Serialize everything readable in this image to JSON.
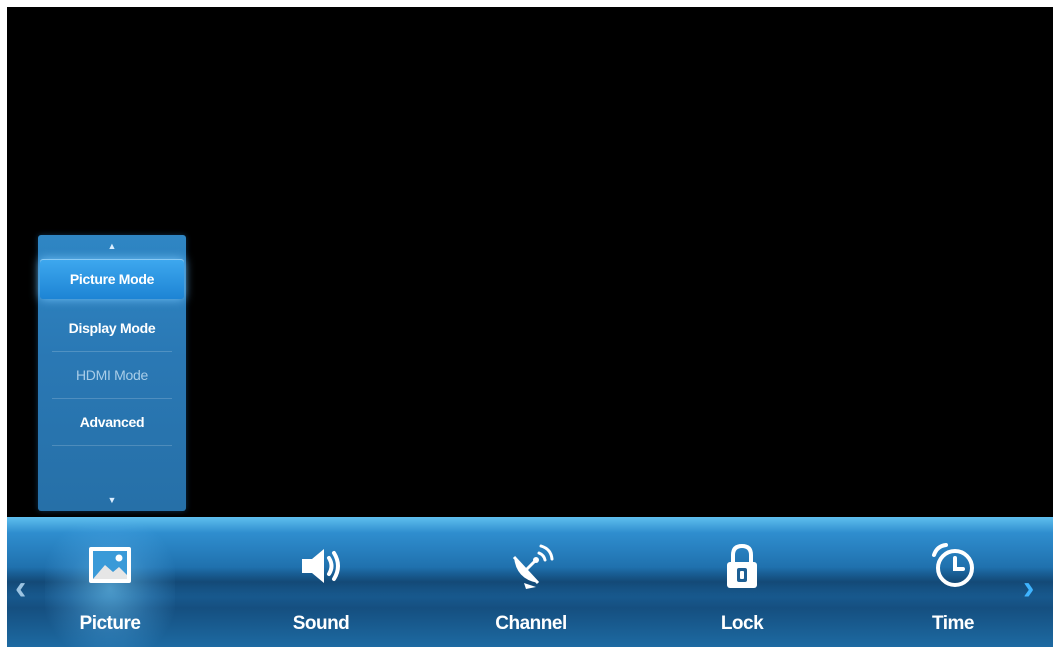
{
  "submenu": {
    "items": [
      {
        "label": "Picture Mode",
        "state": "selected"
      },
      {
        "label": "Display Mode",
        "state": "normal"
      },
      {
        "label": "HDMI Mode",
        "state": "disabled"
      },
      {
        "label": "Advanced",
        "state": "normal"
      }
    ]
  },
  "main_menu": {
    "items": [
      {
        "label": "Picture",
        "icon": "picture-icon",
        "selected": true
      },
      {
        "label": "Sound",
        "icon": "speaker-icon",
        "selected": false
      },
      {
        "label": "Channel",
        "icon": "satellite-dish-icon",
        "selected": false
      },
      {
        "label": "Lock",
        "icon": "lock-icon",
        "selected": false
      },
      {
        "label": "Time",
        "icon": "alarm-clock-icon",
        "selected": false
      }
    ],
    "prev_glyph": "‹",
    "next_glyph": "›"
  },
  "colors": {
    "accent": "#2a86d0",
    "bar_top": "#5fbfee",
    "bar_mid": "#154f80",
    "text": "#ffffff"
  }
}
